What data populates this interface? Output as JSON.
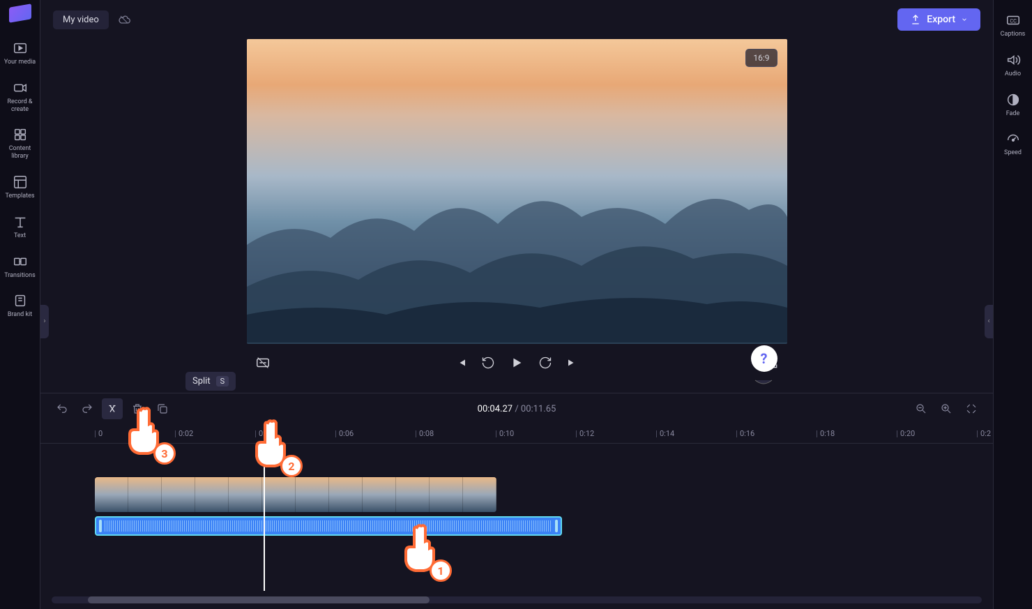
{
  "left_rail": {
    "items": [
      {
        "label": "Your media",
        "icon": "media-icon"
      },
      {
        "label": "Record & create",
        "icon": "camera-icon"
      },
      {
        "label": "Content library",
        "icon": "library-icon"
      },
      {
        "label": "Templates",
        "icon": "templates-icon"
      },
      {
        "label": "Text",
        "icon": "text-icon"
      },
      {
        "label": "Transitions",
        "icon": "transitions-icon"
      },
      {
        "label": "Brand kit",
        "icon": "brandkit-icon"
      }
    ]
  },
  "right_rail": {
    "items": [
      {
        "label": "Captions",
        "icon": "captions-icon"
      },
      {
        "label": "Audio",
        "icon": "audio-icon"
      },
      {
        "label": "Fade",
        "icon": "fade-icon"
      },
      {
        "label": "Speed",
        "icon": "speed-icon"
      }
    ]
  },
  "header": {
    "title": "My video",
    "export_label": "Export"
  },
  "preview": {
    "aspect": "16:9"
  },
  "timeline": {
    "tooltip_label": "Split",
    "tooltip_key": "S",
    "current_time": "00:04.27",
    "total_time": "00:11.65",
    "ticks": [
      "0",
      "0:02",
      "0:04",
      "0:06",
      "0:08",
      "0:10",
      "0:12",
      "0:14",
      "0:16",
      "0:18",
      "0:20",
      "0:2"
    ]
  },
  "annotations": {
    "hand1": "1",
    "hand2": "2",
    "hand3": "3"
  },
  "help": "?"
}
